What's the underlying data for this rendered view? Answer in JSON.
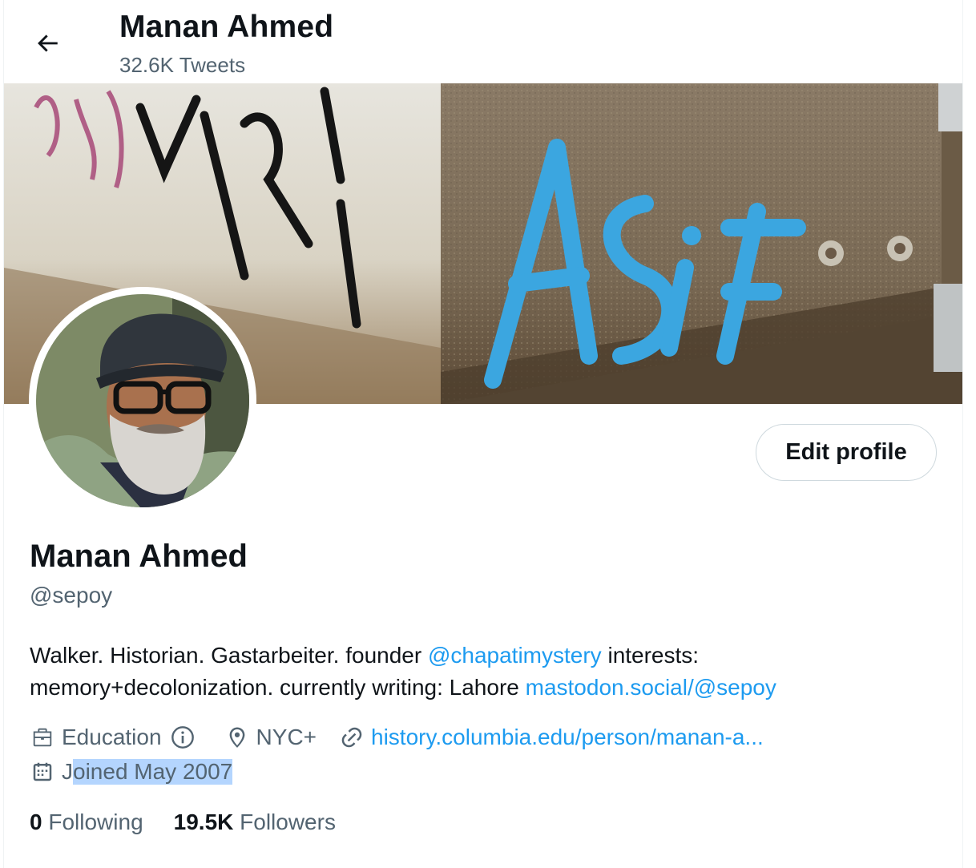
{
  "header": {
    "title": "Manan Ahmed",
    "tweet_count": "32.6K Tweets"
  },
  "banner": {
    "graffiti_text": "ASIF"
  },
  "profile": {
    "display_name": "Manan Ahmed",
    "handle": "@sepoy",
    "edit_label": "Edit profile",
    "bio": {
      "part1": "Walker. Historian. Gastarbeiter. founder ",
      "mention": "@chapatimystery",
      "part2": " interests: memory+decolonization. currently writing: Lahore ",
      "link": "mastodon.social/@sepoy"
    },
    "category": "Education",
    "location": "NYC+",
    "website": "history.columbia.edu/person/manan-a...",
    "joined": {
      "prefix": "J",
      "highlighted": "oined May 2007"
    },
    "stats": {
      "following_count": "0",
      "following_label": "Following",
      "followers_count": "19.5K",
      "followers_label": "Followers"
    }
  },
  "colors": {
    "accent": "#1d9bf0",
    "secondary_text": "#536471",
    "selection": "#b4d5fe"
  },
  "icons": [
    "arrow-left-icon",
    "briefcase-icon",
    "info-icon",
    "location-pin-icon",
    "link-icon",
    "calendar-icon"
  ]
}
